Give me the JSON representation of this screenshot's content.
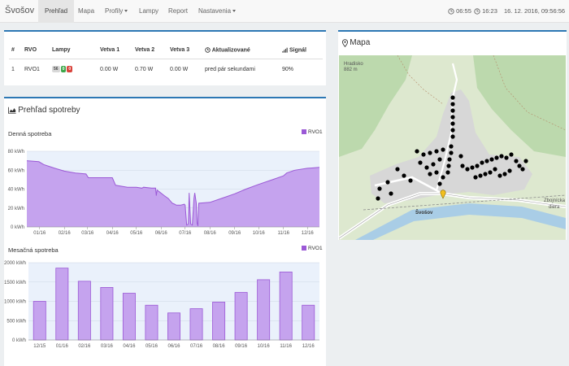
{
  "navbar": {
    "brand": "Švošov",
    "items": [
      {
        "label": "Prehľad",
        "active": true
      },
      {
        "label": "Mapa"
      },
      {
        "label": "Profily",
        "dropdown": true
      },
      {
        "label": "Lampy"
      },
      {
        "label": "Report"
      },
      {
        "label": "Nastavenia",
        "dropdown": true
      }
    ],
    "sunrise": "06:55",
    "sunset": "16:23",
    "datetime": "16. 12. 2016, 09:56:56"
  },
  "rvo_table": {
    "headers": [
      "#",
      "RVO",
      "Lampy",
      "Vetva 1",
      "Vetva 2",
      "Vetva 3",
      "Aktualizované",
      "Signál"
    ],
    "rows": [
      {
        "num": "1",
        "name": "RVO1",
        "lamps": [
          "56",
          "0",
          "0"
        ],
        "v1": "0.00 W",
        "v2": "0.70 W",
        "v3": "0.00 W",
        "updated": "pred pár sekundami",
        "signal": "90%"
      }
    ]
  },
  "overview": {
    "title": "Prehľad spotreby"
  },
  "map": {
    "title": "Mapa",
    "labels": {
      "town": "Švošov",
      "peak": "Hradisko",
      "peak_alt": "882 m",
      "east1": "Zbojnícka",
      "east2": "diera"
    },
    "colors": {
      "land": "#dde8cf",
      "village": "#d7d7d7",
      "forest": "#bcd9ad",
      "river": "#a9cde6",
      "road": "#ffffff"
    }
  },
  "chart_data": [
    {
      "type": "area",
      "title": "Denná spotreba",
      "legend": "RVO1",
      "ylabel_ticks": [
        "0 kWh",
        "20 kWh",
        "40 kWh",
        "60 kWh",
        "80 kWh"
      ],
      "ylim": [
        0,
        80
      ],
      "xlim": [
        "2015-12-16",
        "2016-12-16"
      ],
      "x_ticks": [
        "01/16",
        "02/16",
        "03/16",
        "04/16",
        "05/16",
        "06/16",
        "07/16",
        "08/16",
        "09/16",
        "10/16",
        "11/16",
        "12/16"
      ],
      "series": [
        {
          "name": "RVO1",
          "x": [
            "2015-12-16",
            "2015-12-31",
            "2016-01-06",
            "2016-01-20",
            "2016-02-01",
            "2016-02-15",
            "2016-02-28",
            "2016-03-02",
            "2016-03-20",
            "2016-04-01",
            "2016-04-05",
            "2016-04-20",
            "2016-05-01",
            "2016-05-08",
            "2016-05-10",
            "2016-05-20",
            "2016-05-25",
            "2016-05-26",
            "2016-05-27",
            "2016-06-05",
            "2016-06-10",
            "2016-06-15",
            "2016-06-18",
            "2016-06-20",
            "2016-06-25",
            "2016-06-30",
            "2016-07-01",
            "2016-07-03",
            "2016-07-05",
            "2016-07-06",
            "2016-07-08",
            "2016-07-10",
            "2016-07-12",
            "2016-07-13",
            "2016-07-15",
            "2016-07-16",
            "2016-07-17",
            "2016-07-18",
            "2016-08-01",
            "2016-08-15",
            "2016-09-01",
            "2016-09-15",
            "2016-10-01",
            "2016-10-15",
            "2016-11-01",
            "2016-11-05",
            "2016-11-15",
            "2016-12-01",
            "2016-12-16"
          ],
          "values": [
            70,
            69,
            66,
            62,
            59,
            57,
            56,
            52,
            52,
            52,
            44,
            42,
            42,
            41,
            42,
            41,
            41,
            33,
            39,
            33,
            30,
            25,
            24,
            23,
            23,
            24,
            23,
            2,
            3,
            36,
            3,
            2,
            30,
            36,
            25,
            4,
            1,
            25,
            26,
            30,
            35,
            40,
            45,
            49,
            54,
            57,
            60,
            62,
            63
          ]
        }
      ]
    },
    {
      "type": "bar",
      "title": "Mesačná spotreba",
      "legend": "RVO1",
      "ylabel_ticks": [
        "0 kWh",
        "500 kWh",
        "1000 kWh",
        "1500 kWh",
        "2000 kWh"
      ],
      "ylim": [
        0,
        2000
      ],
      "categories": [
        "12/15",
        "01/16",
        "02/16",
        "03/16",
        "04/16",
        "05/16",
        "06/16",
        "07/16",
        "08/16",
        "09/16",
        "10/16",
        "11/16",
        "12/16"
      ],
      "series": [
        {
          "name": "RVO1",
          "values": [
            1000,
            1860,
            1520,
            1360,
            1210,
            900,
            700,
            810,
            980,
            1230,
            1560,
            1760,
            900
          ]
        }
      ]
    }
  ],
  "colors": {
    "accent": "#2d78b4",
    "series": "#9b59d6",
    "series_fill": "#c5a3ee",
    "badge_green": "#3ea64a",
    "badge_red": "#d9443c"
  }
}
